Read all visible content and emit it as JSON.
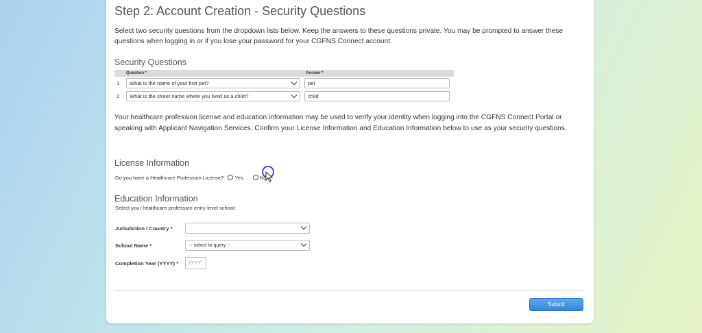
{
  "page": {
    "title": "Step 2: Account Creation - Security Questions",
    "intro": "Select two security questions from the dropdown lists below. Keep the answers to these questions private. You may be prompted to answer these questions when logging in or if you lose your password for your CGFNS Connect account."
  },
  "security": {
    "heading": "Security Questions",
    "col_question": "Question *",
    "col_answer": "Answer *",
    "rows": [
      {
        "num": "1",
        "question": "What is the name of your first pet?",
        "answer": "pet"
      },
      {
        "num": "2",
        "question": "What is the street name where you lived as a child?",
        "answer": "child"
      }
    ]
  },
  "license": {
    "paragraph": "Your healthcare profession license and education information may be used to verify your identity when logging into the CGFNS Connect Portal or speaking with Applicant Navigation Services. Confirm your License Information and Education Information below to use as your security questions.",
    "heading": "License Information",
    "question": "Do you have a Healthcare Profession License?",
    "yes_label": "Yes",
    "no_label": "No"
  },
  "education": {
    "heading": "Education Information",
    "subtext": "Select your healthcare profession entry-level school:",
    "jurisdiction_label": "Jurisdiction / Country *",
    "jurisdiction_value": "",
    "school_label": "School Name *",
    "school_value": "-- select to query --",
    "year_label": "Completion Year (YYYY) *",
    "year_placeholder": "YYYY"
  },
  "actions": {
    "submit_label": "Submit"
  },
  "colors": {
    "accent": "#2f86dc",
    "click_ring": "#4b3fc4"
  }
}
